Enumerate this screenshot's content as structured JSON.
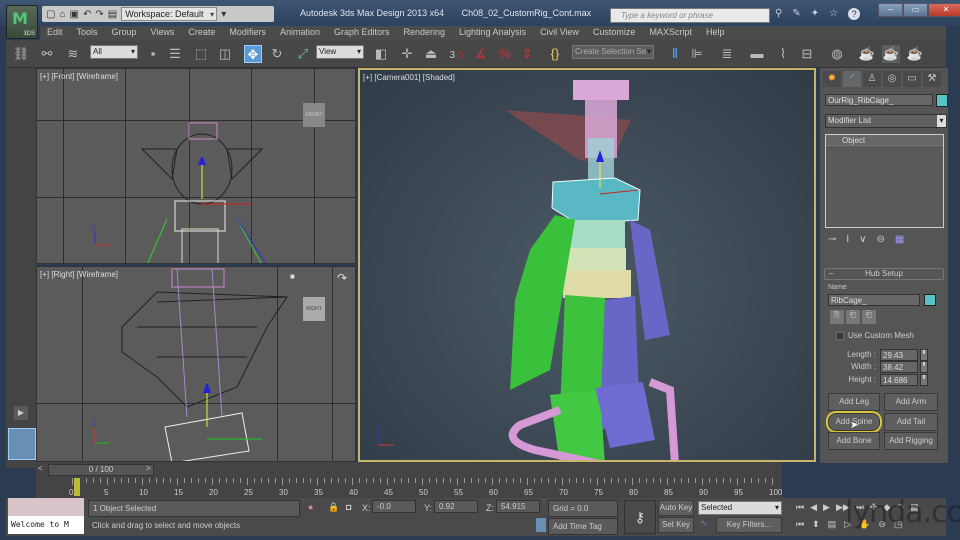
{
  "window": {
    "title": "Autodesk 3ds Max Design 2013 x64",
    "filename": "Ch08_02_CustomRig_Cont.max",
    "app_button_label": "3DS",
    "workspace": "Workspace: Default",
    "search_placeholder": "Type a keyword or phrase",
    "controls": [
      "minimize",
      "maximize",
      "close"
    ]
  },
  "menu": [
    "Edit",
    "Tools",
    "Group",
    "Views",
    "Create",
    "Modifiers",
    "Animation",
    "Graph Editors",
    "Rendering",
    "Lighting Analysis",
    "Civil View",
    "Customize",
    "MAXScript",
    "Help"
  ],
  "toolbar": {
    "selection_filter": "All",
    "reference_coord": "View",
    "snap_angle_label": "3",
    "named_selection": "Create Selection Se",
    "active_tool": "select-and-move"
  },
  "viewports": {
    "front": {
      "label": "[+] [Front] [Wireframe]",
      "viewcube": "FRONT"
    },
    "right": {
      "label": "[+] [Right] [Wireframe]",
      "viewcube": "RIGHT"
    },
    "camera": {
      "label": "[+] [Camera001] [Shaded]"
    }
  },
  "command_panel": {
    "object_name": "OurRig_RibCage_",
    "object_color": "#55c4c4",
    "modifier_list": "Modifier List",
    "stack_item": "Object",
    "rollout_title": "Hub Setup",
    "name_label": "Name",
    "name_value": "RibCage_",
    "use_custom_mesh_label": "Use Custom Mesh",
    "use_custom_mesh_checked": false,
    "length_label": "Length :",
    "length_value": "29.43",
    "width_label": "Width :",
    "width_value": "38.42",
    "height_label": "Height :",
    "height_value": "14.686",
    "buttons": [
      "Add Leg",
      "Add Arm",
      "Add Spine",
      "Add Tail",
      "Add Bone",
      "Add Rigging"
    ],
    "highlighted_button": "Add Spine"
  },
  "timeline": {
    "frame_display": "0 / 100",
    "prev": "<",
    "next": ">",
    "current_frame": "0",
    "ticks": [
      "0",
      "5",
      "10",
      "15",
      "20",
      "25",
      "30",
      "35",
      "40",
      "45",
      "50",
      "55",
      "60",
      "65",
      "70",
      "75",
      "80",
      "85",
      "90",
      "95",
      "100"
    ]
  },
  "status": {
    "maxscript_listener": "Welcome to M",
    "selection_status": "1 Object Selected",
    "prompt": "Click and drag to select and move objects",
    "x_label": "X:",
    "x_value": "-0.0",
    "y_label": "Y:",
    "y_value": "0.92",
    "z_label": "Z:",
    "z_value": "54.915",
    "grid": "Grid = 0.0",
    "add_time_tag": "Add Time Tag",
    "auto_key": "Auto Key",
    "set_key": "Set Key",
    "key_mode": "Selected",
    "key_filters": "Key Filters..."
  },
  "watermark": "lynda.com"
}
